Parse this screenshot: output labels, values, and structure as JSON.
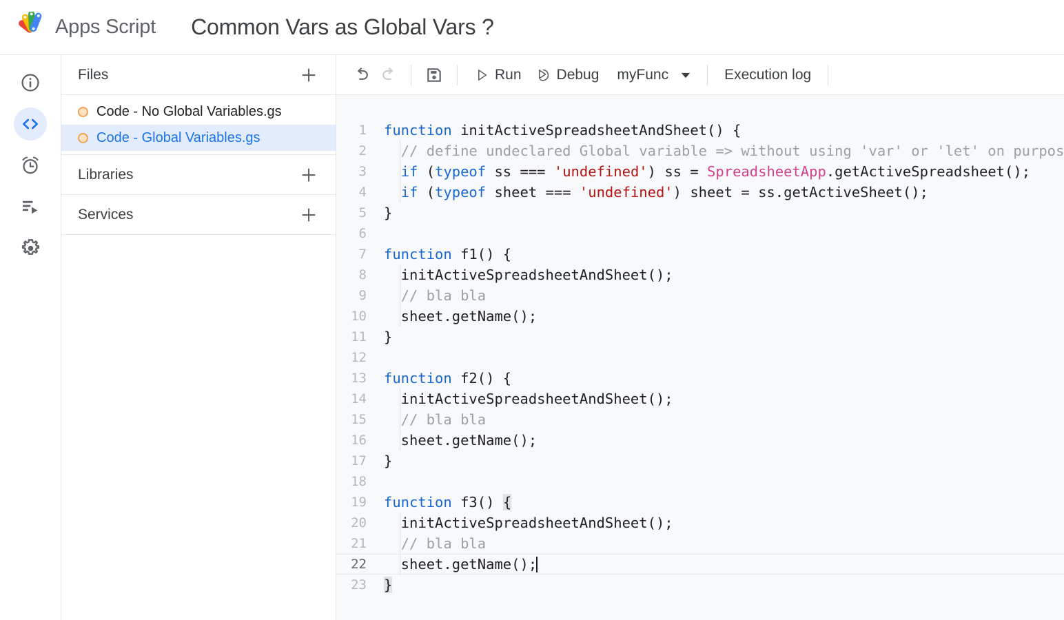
{
  "header": {
    "brand_name": "Apps Script",
    "logo_icon": "apps-script-logo",
    "project_title": "Common Vars as Global Vars ?"
  },
  "rail": {
    "items": [
      {
        "icon": "info-icon",
        "name": "overview",
        "active": false
      },
      {
        "icon": "code-icon",
        "name": "editor",
        "active": true
      },
      {
        "icon": "alarm-clock-icon",
        "name": "triggers",
        "active": false
      },
      {
        "icon": "executions-icon",
        "name": "executions",
        "active": false
      },
      {
        "icon": "gear-icon",
        "name": "settings",
        "active": false
      }
    ]
  },
  "sidebar": {
    "sections": [
      {
        "title": "Files",
        "add_icon": "plus-icon"
      },
      {
        "title": "Libraries",
        "add_icon": "plus-icon"
      },
      {
        "title": "Services",
        "add_icon": "plus-icon"
      }
    ],
    "files": [
      {
        "name": "Code - No Global Variables.gs",
        "status_icon": "file-dot-icon",
        "selected": false
      },
      {
        "name": "Code - Global Variables.gs",
        "status_icon": "file-dot-icon",
        "selected": true
      }
    ]
  },
  "toolbar": {
    "undo_icon": "undo-icon",
    "redo_icon": "redo-icon",
    "save_icon": "save-icon",
    "run_label": "Run",
    "run_icon": "play-icon",
    "debug_label": "Debug",
    "debug_icon": "debug-icon",
    "function_name": "myFunc",
    "function_caret_icon": "chevron-down-icon",
    "execution_log_label": "Execution log"
  },
  "editor": {
    "active_line": 22,
    "cursor_line": 22,
    "cursor_column": 21,
    "total_visible_lines": 23,
    "colors": {
      "background": "#f8f9fa",
      "keyword": "#1967d2",
      "string": "#b31412",
      "comment": "#9aa0a6",
      "class": "#d53f8c",
      "plain": "#202124",
      "accent": "#1a73e8",
      "selection": "#e3ecfd"
    },
    "lines": [
      {
        "n": 1,
        "tokens": [
          {
            "t": "kw",
            "v": "function"
          },
          {
            "t": "pln",
            "v": " initActiveSpreadsheetAndSheet() "
          },
          {
            "t": "pln",
            "v": "{"
          }
        ]
      },
      {
        "n": 2,
        "indent": true,
        "tokens": [
          {
            "t": "pln",
            "v": "  "
          },
          {
            "t": "com",
            "v": "// define undeclared Global variable => without using 'var' or 'let' on purpose"
          }
        ]
      },
      {
        "n": 3,
        "indent": true,
        "tokens": [
          {
            "t": "pln",
            "v": "  "
          },
          {
            "t": "kw",
            "v": "if"
          },
          {
            "t": "pln",
            "v": " ("
          },
          {
            "t": "kw",
            "v": "typeof"
          },
          {
            "t": "pln",
            "v": " ss === "
          },
          {
            "t": "str",
            "v": "'undefined'"
          },
          {
            "t": "pln",
            "v": ") ss = "
          },
          {
            "t": "cls",
            "v": "SpreadsheetApp"
          },
          {
            "t": "pln",
            "v": ".getActiveSpreadsheet();"
          }
        ]
      },
      {
        "n": 4,
        "indent": true,
        "tokens": [
          {
            "t": "pln",
            "v": "  "
          },
          {
            "t": "kw",
            "v": "if"
          },
          {
            "t": "pln",
            "v": " ("
          },
          {
            "t": "kw",
            "v": "typeof"
          },
          {
            "t": "pln",
            "v": " sheet === "
          },
          {
            "t": "str",
            "v": "'undefined'"
          },
          {
            "t": "pln",
            "v": ") sheet = ss.getActiveSheet();"
          }
        ]
      },
      {
        "n": 5,
        "tokens": [
          {
            "t": "pln",
            "v": "}"
          }
        ]
      },
      {
        "n": 6,
        "tokens": []
      },
      {
        "n": 7,
        "tokens": [
          {
            "t": "kw",
            "v": "function"
          },
          {
            "t": "pln",
            "v": " f1() {"
          }
        ]
      },
      {
        "n": 8,
        "indent": true,
        "tokens": [
          {
            "t": "pln",
            "v": "  initActiveSpreadsheetAndSheet();"
          }
        ]
      },
      {
        "n": 9,
        "indent": true,
        "tokens": [
          {
            "t": "pln",
            "v": "  "
          },
          {
            "t": "com",
            "v": "// bla bla"
          }
        ]
      },
      {
        "n": 10,
        "indent": true,
        "tokens": [
          {
            "t": "pln",
            "v": "  sheet.getName();"
          }
        ]
      },
      {
        "n": 11,
        "tokens": [
          {
            "t": "pln",
            "v": "}"
          }
        ]
      },
      {
        "n": 12,
        "tokens": []
      },
      {
        "n": 13,
        "tokens": [
          {
            "t": "kw",
            "v": "function"
          },
          {
            "t": "pln",
            "v": " f2() {"
          }
        ]
      },
      {
        "n": 14,
        "indent": true,
        "tokens": [
          {
            "t": "pln",
            "v": "  initActiveSpreadsheetAndSheet();"
          }
        ]
      },
      {
        "n": 15,
        "indent": true,
        "tokens": [
          {
            "t": "pln",
            "v": "  "
          },
          {
            "t": "com",
            "v": "// bla bla"
          }
        ]
      },
      {
        "n": 16,
        "indent": true,
        "tokens": [
          {
            "t": "pln",
            "v": "  sheet.getName();"
          }
        ]
      },
      {
        "n": 17,
        "tokens": [
          {
            "t": "pln",
            "v": "}"
          }
        ]
      },
      {
        "n": 18,
        "tokens": []
      },
      {
        "n": 19,
        "tokens": [
          {
            "t": "kw",
            "v": "function"
          },
          {
            "t": "pln",
            "v": " f3() "
          },
          {
            "t": "brk",
            "v": "{"
          }
        ]
      },
      {
        "n": 20,
        "indent": true,
        "tokens": [
          {
            "t": "pln",
            "v": "  initActiveSpreadsheetAndSheet();"
          }
        ]
      },
      {
        "n": 21,
        "indent": true,
        "tokens": [
          {
            "t": "pln",
            "v": "  "
          },
          {
            "t": "com",
            "v": "// bla bla"
          }
        ]
      },
      {
        "n": 22,
        "indent": true,
        "active": true,
        "cursor": true,
        "tokens": [
          {
            "t": "pln",
            "v": "  sheet.getName();"
          }
        ]
      },
      {
        "n": 23,
        "tokens": [
          {
            "t": "brk",
            "v": "}"
          }
        ]
      }
    ]
  }
}
